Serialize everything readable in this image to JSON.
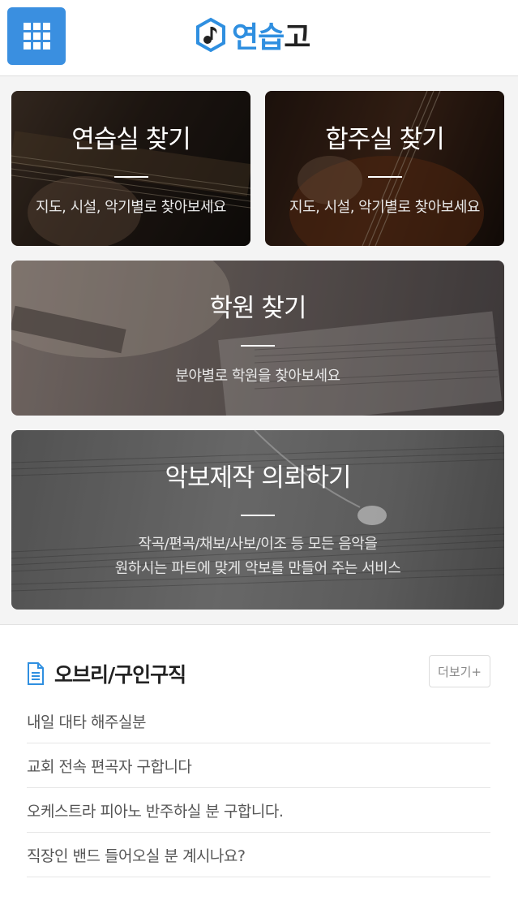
{
  "header": {
    "logo_part1": "연습",
    "logo_part2": "고",
    "menu_icon": "grid-menu-icon",
    "brand_color": "#2f8fe0"
  },
  "cards": [
    {
      "title": "연습실 찾기",
      "subtitle": "지도, 시설, 악기별로 찾아보세요"
    },
    {
      "title": "합주실 찾기",
      "subtitle": "지도, 시설, 악기별로 찾아보세요"
    },
    {
      "title": "학원 찾기",
      "subtitle": "분야별로 학원을 찾아보세요"
    },
    {
      "title": "악보제작 의뢰하기",
      "subtitle_line1": "작곡/편곡/채보/사보/이조 등 모든 음악을",
      "subtitle_line2": "원하시는 파트에 맞게 악보를 만들어 주는 서비스"
    }
  ],
  "board": {
    "title": "오브리/구인구직",
    "icon": "document-icon",
    "more_label": "더보기+",
    "items": [
      "내일 대타 해주실분",
      "교회 전속 편곡자 구합니다",
      "오케스트라 피아노 반주하실 분 구합니다.",
      "직장인 밴드 들어오실 분 계시나요?"
    ]
  }
}
